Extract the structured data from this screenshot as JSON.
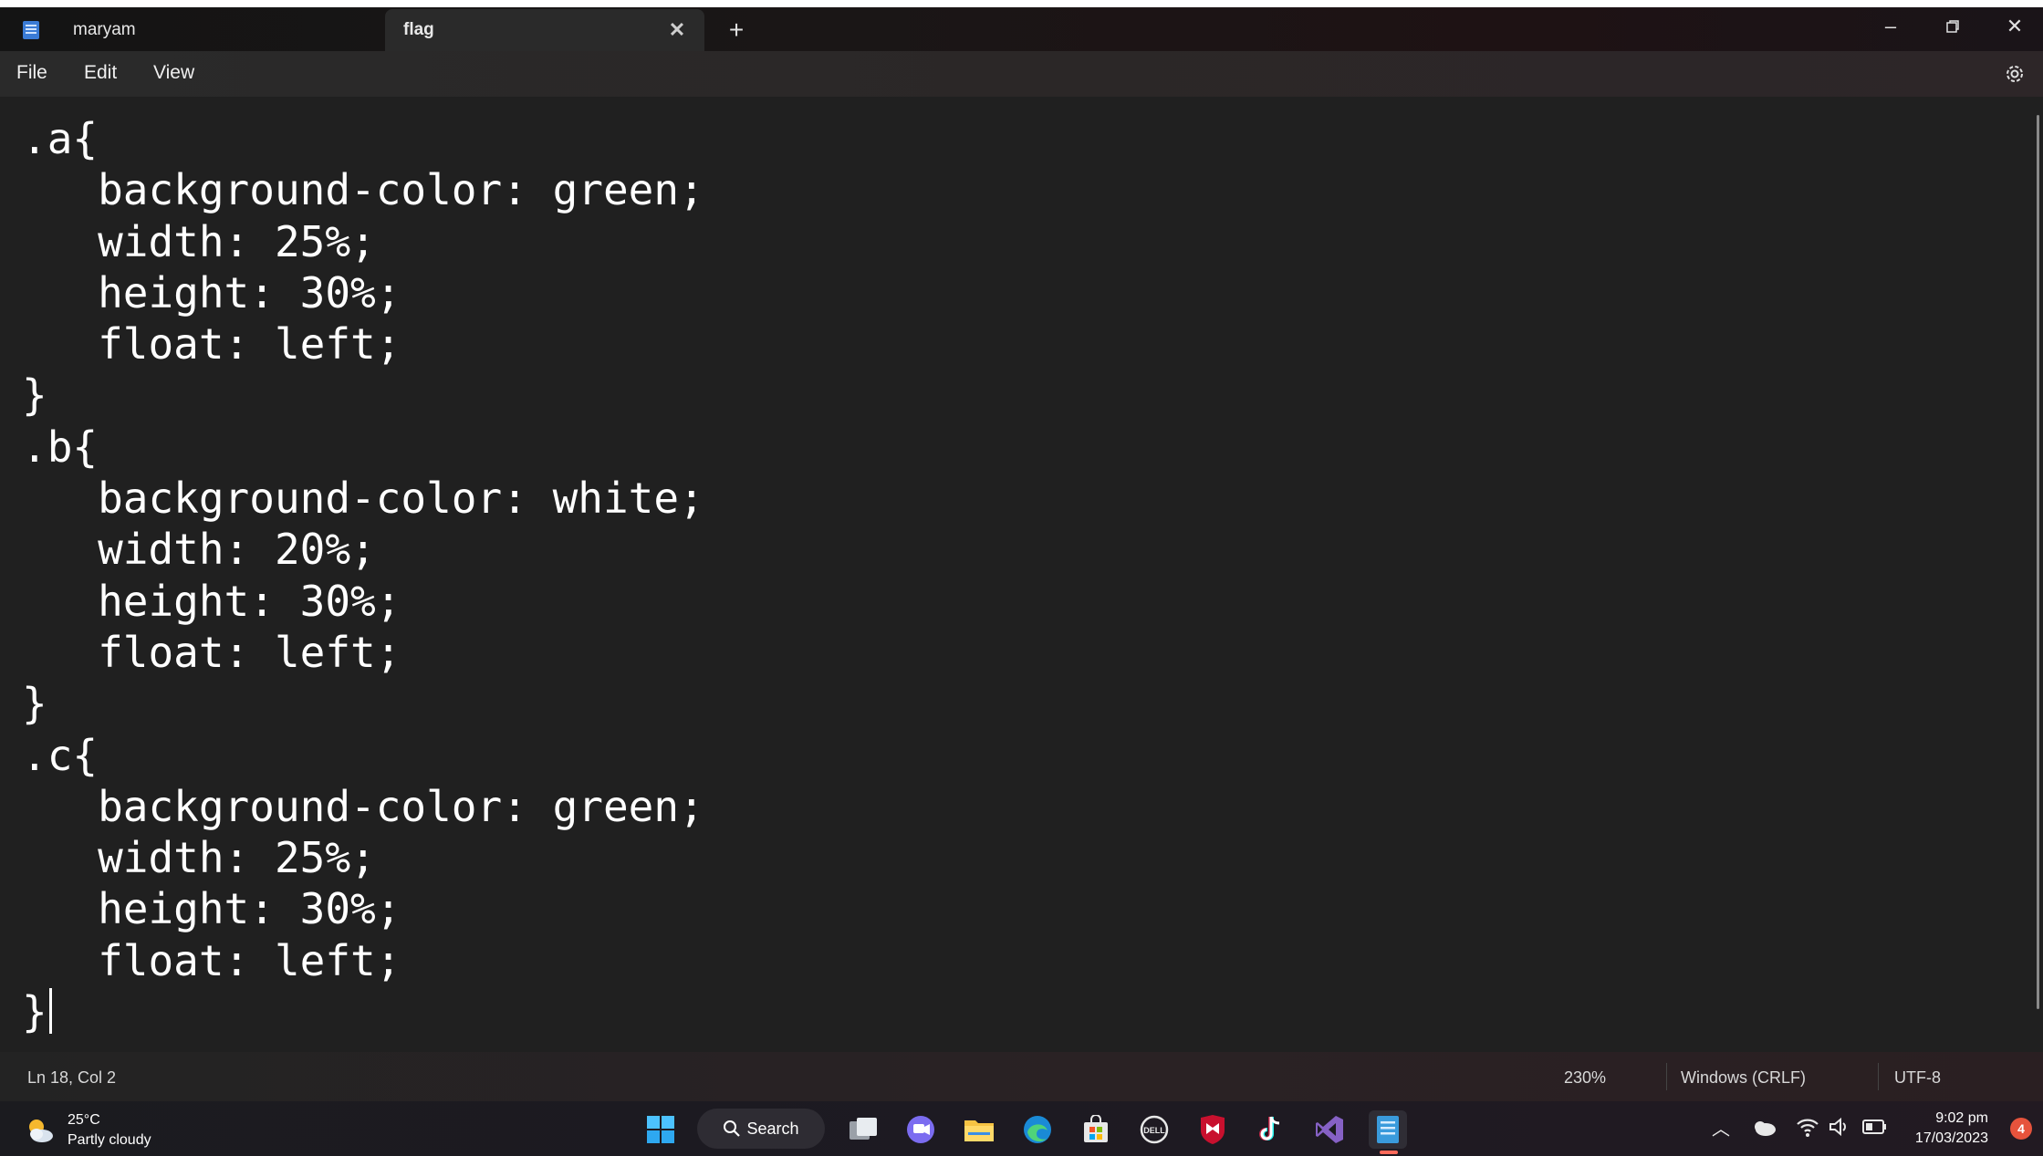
{
  "tabs": [
    {
      "label": "maryam",
      "active": false
    },
    {
      "label": "flag",
      "active": true
    }
  ],
  "menu": {
    "file": "File",
    "edit": "Edit",
    "view": "View"
  },
  "code_lines": [
    ".a{",
    "   background-color: green;",
    "   width: 25%;",
    "   height: 30%;",
    "   float: left;",
    "}",
    ".b{",
    "   background-color: white;",
    "   width: 20%;",
    "   height: 30%;",
    "   float: left;",
    "}",
    ".c{",
    "   background-color: green;",
    "   width: 25%;",
    "   height: 30%;",
    "   float: left;",
    "}"
  ],
  "status": {
    "position": "Ln 18, Col 2",
    "zoom": "230%",
    "line_ending": "Windows (CRLF)",
    "encoding": "UTF-8"
  },
  "taskbar": {
    "temperature": "25°C",
    "weather_desc": "Partly cloudy",
    "search_label": "Search",
    "time": "9:02 pm",
    "date": "17/03/2023",
    "notification_count": "4"
  },
  "colors": {
    "editor_bg": "#202020",
    "accent_notif": "#e6533c"
  },
  "icons": [
    "notepad-icon",
    "close-icon",
    "plus-icon",
    "minimize-icon",
    "maximize-icon",
    "settings-icon",
    "weather-icon",
    "start-icon",
    "search-icon",
    "task-view-icon",
    "teams-chat-icon",
    "file-explorer-icon",
    "edge-icon",
    "store-icon",
    "dell-icon",
    "mcafee-icon",
    "tiktok-icon",
    "visual-studio-icon",
    "wifi-icon",
    "volume-icon",
    "battery-icon",
    "onedrive-icon",
    "chevron-up-icon"
  ]
}
